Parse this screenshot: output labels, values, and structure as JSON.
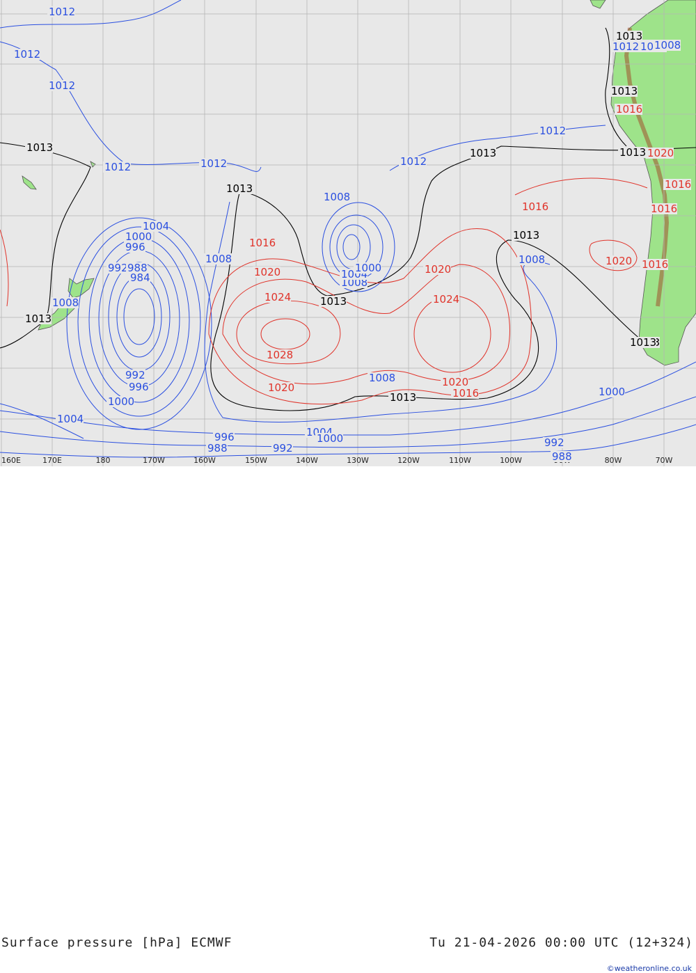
{
  "title_left": "Surface pressure [hPa] ECMWF",
  "title_right": "Tu 21-04-2026 00:00 UTC (12+324)",
  "credit": "©weatheronline.co.uk",
  "colors": {
    "ocean": "#e8e8e8",
    "land": "#9ee38a",
    "grid": "#b4b4b4",
    "low": "#2a4fe0",
    "high": "#e0332a",
    "standard": "#000000",
    "terrain_brown": "#a0522d"
  },
  "longitude_labels": [
    "160E",
    "170E",
    "180",
    "170W",
    "160W",
    "150W",
    "140W",
    "130W",
    "120W",
    "110W",
    "100W",
    "90W",
    "80W",
    "70W"
  ],
  "isobar_labels": {
    "low": [
      {
        "text": "1012"
      },
      {
        "text": "1012"
      },
      {
        "text": "1012"
      },
      {
        "text": "1012"
      },
      {
        "text": "1012"
      },
      {
        "text": "1012"
      },
      {
        "text": "1012"
      },
      {
        "text": "1012"
      },
      {
        "text": "1008"
      },
      {
        "text": "1008"
      },
      {
        "text": "1008"
      },
      {
        "text": "1008"
      },
      {
        "text": "1008"
      },
      {
        "text": "1008"
      },
      {
        "text": "1004"
      },
      {
        "text": "1004"
      },
      {
        "text": "1004"
      },
      {
        "text": "1004"
      },
      {
        "text": "1000"
      },
      {
        "text": "1000"
      },
      {
        "text": "1000"
      },
      {
        "text": "1000"
      },
      {
        "text": "1000"
      },
      {
        "text": "996"
      },
      {
        "text": "996"
      },
      {
        "text": "996"
      },
      {
        "text": "992"
      },
      {
        "text": "992"
      },
      {
        "text": "992"
      },
      {
        "text": "992"
      },
      {
        "text": "988"
      },
      {
        "text": "988"
      },
      {
        "text": "988"
      },
      {
        "text": "984"
      },
      {
        "text": "1012"
      },
      {
        "text": "1012"
      },
      {
        "text": "1008"
      }
    ],
    "high": [
      {
        "text": "1016"
      },
      {
        "text": "1016"
      },
      {
        "text": "1016"
      },
      {
        "text": "1016"
      },
      {
        "text": "1020"
      },
      {
        "text": "1020"
      },
      {
        "text": "1020"
      },
      {
        "text": "1020"
      },
      {
        "text": "1024"
      },
      {
        "text": "1024"
      },
      {
        "text": "1028"
      },
      {
        "text": "1016"
      },
      {
        "text": "1020"
      },
      {
        "text": "1020"
      },
      {
        "text": "1016"
      },
      {
        "text": "1016"
      }
    ],
    "standard": [
      {
        "text": "1013"
      },
      {
        "text": "1013"
      },
      {
        "text": "1013"
      },
      {
        "text": "1013"
      },
      {
        "text": "1013"
      },
      {
        "text": "1013"
      },
      {
        "text": "1013"
      },
      {
        "text": "1013"
      },
      {
        "text": "1013"
      },
      {
        "text": "1013"
      },
      {
        "text": "1013"
      },
      {
        "text": "1013"
      }
    ]
  }
}
